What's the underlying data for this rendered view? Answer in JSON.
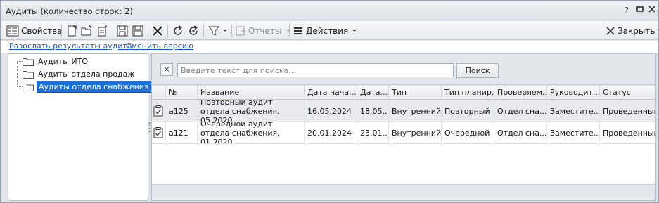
{
  "window": {
    "title": "Аудиты (количество строк: 2)",
    "help_label": "?"
  },
  "toolbar": {
    "properties_label": "Свойства",
    "reports_label": "Отчеты",
    "actions_label": "Действия",
    "close_label": "Закрыть"
  },
  "links": {
    "send_results": "Разослать результаты аудита",
    "change_version": "Сменить версию"
  },
  "tree": {
    "items": [
      {
        "label": "Аудиты ИТО"
      },
      {
        "label": "Аудиты отдела продаж"
      },
      {
        "label": "Аудиты отдела снабжения",
        "selected": true
      }
    ]
  },
  "search": {
    "clear_label": "×",
    "placeholder": "Введите текст для поиска...",
    "button_label": "Поиск"
  },
  "table": {
    "columns": [
      "№",
      "Название",
      "Дата нача...",
      "Дата...",
      "Тип",
      "Тип планир...",
      "Проверяем...",
      "Руководит...",
      "Статус"
    ],
    "rows": [
      {
        "number": "а125",
        "name": "Повторный аудит отдела снабжения, 05.2020",
        "start_date": "16.05.2024",
        "end_date": "18.05...",
        "type": "Внутренний",
        "plan_type": "Повторный",
        "audited": "Отдел сна...",
        "manager": "Заместите...",
        "status": "Проведенный"
      },
      {
        "number": "а121",
        "name": "Очередной аудит отдела снабжения, 01.2020",
        "start_date": "20.01.2024",
        "end_date": "23.01...",
        "type": "Внутренний",
        "plan_type": "Очередной",
        "audited": "Отдел сна...",
        "manager": "Заместите...",
        "status": "Проведенный"
      }
    ]
  },
  "colors": {
    "selection": "#1d6fdc",
    "link": "#1a55c8",
    "window_bg": "#dfe3e8"
  }
}
